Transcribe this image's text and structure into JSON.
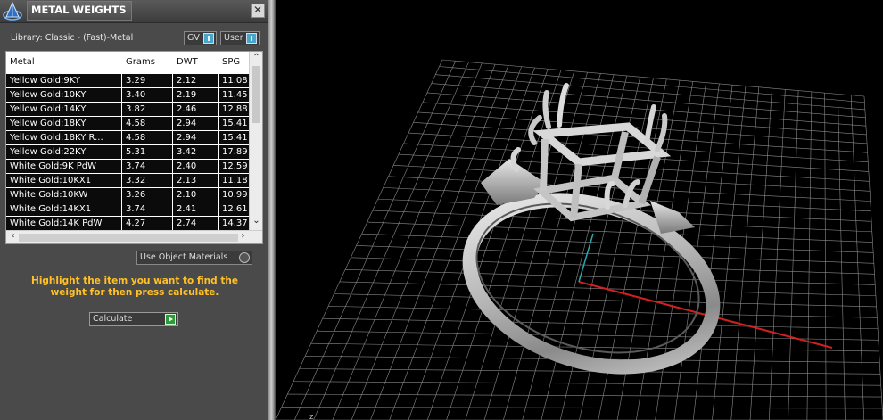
{
  "window": {
    "title": "METAL WEIGHTS",
    "close_label": "✕"
  },
  "library": {
    "label": "Library: Classic - (Fast)-Metal",
    "gv_label": "GV",
    "user_label": "User"
  },
  "table": {
    "headers": [
      "Metal",
      "Grams",
      "DWT",
      "SPG"
    ],
    "rows": [
      [
        "Yellow Gold:9KY",
        "3.29",
        "2.12",
        "11.08"
      ],
      [
        "Yellow Gold:10KY",
        "3.40",
        "2.19",
        "11.45"
      ],
      [
        "Yellow Gold:14KY",
        "3.82",
        "2.46",
        "12.88"
      ],
      [
        "Yellow Gold:18KY",
        "4.58",
        "2.94",
        "15.41"
      ],
      [
        "Yellow Gold:18KY R...",
        "4.58",
        "2.94",
        "15.41"
      ],
      [
        "Yellow Gold:22KY",
        "5.31",
        "3.42",
        "17.89"
      ],
      [
        "White Gold:9K PdW",
        "3.74",
        "2.40",
        "12.59"
      ],
      [
        "White Gold:10KX1",
        "3.32",
        "2.13",
        "11.18"
      ],
      [
        "White Gold:10KW",
        "3.26",
        "2.10",
        "10.99"
      ],
      [
        "White Gold:14KX1",
        "3.74",
        "2.41",
        "12.61"
      ],
      [
        "White Gold:14K PdW",
        "4.27",
        "2.74",
        "14.37"
      ]
    ]
  },
  "options": {
    "use_object_materials": "Use Object Materials"
  },
  "hint": "Highlight the item you want to find the weight for then press calculate.",
  "calculate_label": "Calculate",
  "viewport": {
    "axis_label": "z"
  },
  "colors": {
    "panel_bg": "#4a4a4a",
    "hint_text": "#ffc125",
    "x_axis": "#d02020",
    "y_axis": "#2aa6b0",
    "grid": "#8a8a8a"
  }
}
